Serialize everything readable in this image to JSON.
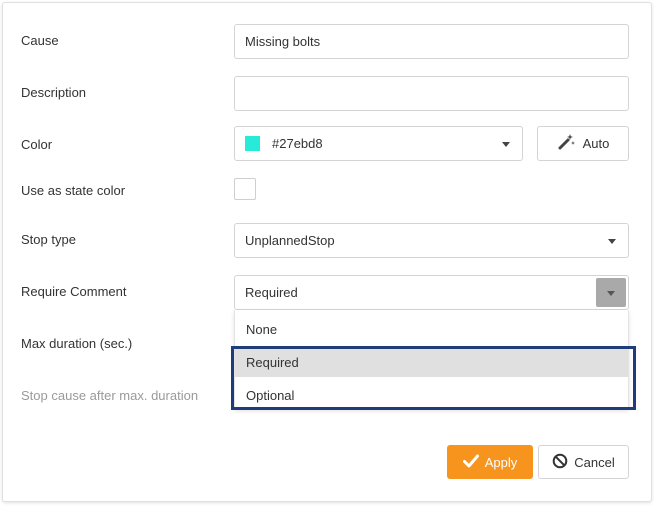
{
  "form": {
    "cause": {
      "label": "Cause",
      "value": "Missing bolts"
    },
    "description": {
      "label": "Description",
      "value": ""
    },
    "color": {
      "label": "Color",
      "value": "#27ebd8",
      "swatch": "#27ebd8",
      "auto_label": "Auto",
      "auto_icon": "magic-wand-icon"
    },
    "use_as_state_color": {
      "label": "Use as state color",
      "checked": false
    },
    "stop_type": {
      "label": "Stop type",
      "value": "UnplannedStop"
    },
    "require_comment": {
      "label": "Require Comment",
      "value": "Required",
      "options": [
        "None",
        "Required",
        "Optional"
      ],
      "highlighted": "Required"
    },
    "max_duration": {
      "label": "Max duration (sec.)"
    },
    "stop_cause_after": {
      "label": "Stop cause after max. duration"
    }
  },
  "actions": {
    "apply_label": "Apply",
    "cancel_label": "Cancel",
    "apply_color": "#f7941d"
  }
}
